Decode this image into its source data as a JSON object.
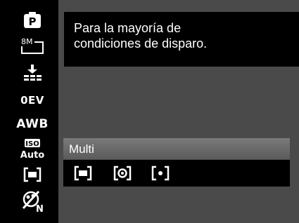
{
  "sidebar": {
    "items": [
      {
        "icon": "program-mode-icon",
        "glyph": "P"
      },
      {
        "icon": "resolution-8m-icon",
        "text": "8M"
      },
      {
        "icon": "exposure-bracket-icon"
      },
      {
        "icon": "exposure-value-icon",
        "text": "0EV"
      },
      {
        "icon": "white-balance-icon",
        "text": "AWB"
      },
      {
        "icon": "iso-auto-icon",
        "text_top": "ISO",
        "text_bottom": "Auto"
      },
      {
        "icon": "metering-multi-icon"
      },
      {
        "icon": "color-off-icon",
        "text": "N"
      }
    ]
  },
  "help": {
    "text_line1": "Para la mayoría de",
    "text_line2": "condiciones de disparo."
  },
  "metering": {
    "selected_label": "Multi",
    "options": [
      {
        "icon": "metering-multi-icon"
      },
      {
        "icon": "metering-center-icon"
      },
      {
        "icon": "metering-spot-icon"
      }
    ]
  },
  "colors": {
    "background": "#4a4a4a",
    "panel": "#000000",
    "highlight_bar": "#7a7a7a",
    "text": "#ffffff"
  }
}
